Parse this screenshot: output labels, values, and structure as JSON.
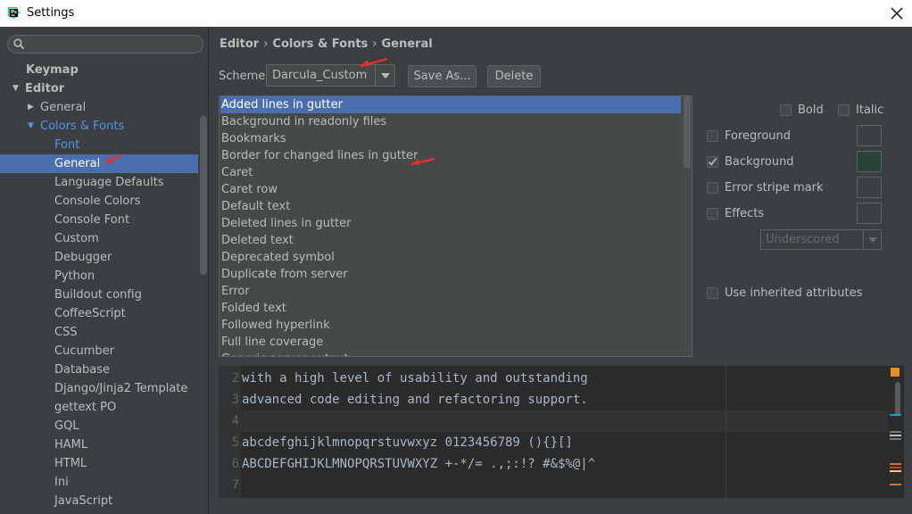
{
  "window": {
    "title": "Settings"
  },
  "search": {
    "placeholder": ""
  },
  "tree": [
    {
      "label": "Keymap",
      "level": 0,
      "bold": true,
      "arrow": "",
      "state": "normal"
    },
    {
      "label": "Editor",
      "level": 0,
      "bold": true,
      "arrow": "down",
      "state": "normal"
    },
    {
      "label": "General",
      "level": 1,
      "bold": false,
      "arrow": "right",
      "state": "normal"
    },
    {
      "label": "Colors & Fonts",
      "level": 1,
      "bold": false,
      "arrow": "down",
      "state": "blue"
    },
    {
      "label": "Font",
      "level": 2,
      "bold": false,
      "arrow": "",
      "state": "blue"
    },
    {
      "label": "General",
      "level": 2,
      "bold": false,
      "arrow": "",
      "state": "selected"
    },
    {
      "label": "Language Defaults",
      "level": 2,
      "bold": false,
      "arrow": "",
      "state": "normal"
    },
    {
      "label": "Console Colors",
      "level": 2,
      "bold": false,
      "arrow": "",
      "state": "normal"
    },
    {
      "label": "Console Font",
      "level": 2,
      "bold": false,
      "arrow": "",
      "state": "normal"
    },
    {
      "label": "Custom",
      "level": 2,
      "bold": false,
      "arrow": "",
      "state": "normal"
    },
    {
      "label": "Debugger",
      "level": 2,
      "bold": false,
      "arrow": "",
      "state": "normal"
    },
    {
      "label": "Python",
      "level": 2,
      "bold": false,
      "arrow": "",
      "state": "normal"
    },
    {
      "label": "Buildout config",
      "level": 2,
      "bold": false,
      "arrow": "",
      "state": "normal"
    },
    {
      "label": "CoffeeScript",
      "level": 2,
      "bold": false,
      "arrow": "",
      "state": "normal"
    },
    {
      "label": "CSS",
      "level": 2,
      "bold": false,
      "arrow": "",
      "state": "normal"
    },
    {
      "label": "Cucumber",
      "level": 2,
      "bold": false,
      "arrow": "",
      "state": "normal"
    },
    {
      "label": "Database",
      "level": 2,
      "bold": false,
      "arrow": "",
      "state": "normal"
    },
    {
      "label": "Django/Jinja2 Template",
      "level": 2,
      "bold": false,
      "arrow": "",
      "state": "normal"
    },
    {
      "label": "gettext PO",
      "level": 2,
      "bold": false,
      "arrow": "",
      "state": "normal"
    },
    {
      "label": "GQL",
      "level": 2,
      "bold": false,
      "arrow": "",
      "state": "normal"
    },
    {
      "label": "HAML",
      "level": 2,
      "bold": false,
      "arrow": "",
      "state": "normal"
    },
    {
      "label": "HTML",
      "level": 2,
      "bold": false,
      "arrow": "",
      "state": "normal"
    },
    {
      "label": "Ini",
      "level": 2,
      "bold": false,
      "arrow": "",
      "state": "normal"
    },
    {
      "label": "JavaScript",
      "level": 2,
      "bold": false,
      "arrow": "",
      "state": "normal"
    }
  ],
  "breadcrumb": {
    "part1": "Editor",
    "part2": "Colors & Fonts",
    "part3": "General",
    "separator": "›"
  },
  "scheme": {
    "label": "Scheme:",
    "value": "Darcula_Custom",
    "save_as": "Save As...",
    "delete": "Delete"
  },
  "attributes": [
    "Added lines in gutter",
    "Background in readonly files",
    "Bookmarks",
    "Border for changed lines in gutter",
    "Caret",
    "Caret row",
    "Default text",
    "Deleted lines in gutter",
    "Deleted text",
    "Deprecated symbol",
    "Duplicate from server",
    "Error",
    "Folded text",
    "Followed hyperlink",
    "Full line coverage",
    "Generic server output"
  ],
  "selected_attribute_index": 0,
  "options": {
    "bold": {
      "label": "Bold",
      "checked": false
    },
    "italic": {
      "label": "Italic",
      "checked": false
    },
    "foreground": {
      "label": "Foreground",
      "checked": false,
      "color": "#3c3f41"
    },
    "background": {
      "label": "Background",
      "checked": true,
      "color": "#294436"
    },
    "error_stripe": {
      "label": "Error stripe mark",
      "checked": false,
      "color": "#3c3f41"
    },
    "effects": {
      "label": "Effects",
      "checked": false,
      "color": "#3c3f41"
    },
    "effect_type": "Underscored",
    "inherited": {
      "label": "Use inherited attributes",
      "checked": false
    }
  },
  "preview": {
    "lines": [
      {
        "num": "2",
        "text": "with a high level of usability and outstanding"
      },
      {
        "num": "3",
        "text": "advanced code editing and refactoring support."
      },
      {
        "num": "4",
        "text": ""
      },
      {
        "num": "5",
        "text": "abcdefghijklmnopqrstuvwxyz 0123456789 (){}[]"
      },
      {
        "num": "6",
        "text": "ABCDEFGHIJKLMNOPQRSTUVWXYZ +-*/= .,;:!? #&$%@|^"
      },
      {
        "num": "7",
        "text": ""
      }
    ],
    "current_line_index": 2
  },
  "colors": {
    "bg": "#3c3f41",
    "selection": "#4b6eaf",
    "link_blue": "#5394ec",
    "editor_bg": "#2b2b2b",
    "annotation_red": "#e8302a"
  }
}
